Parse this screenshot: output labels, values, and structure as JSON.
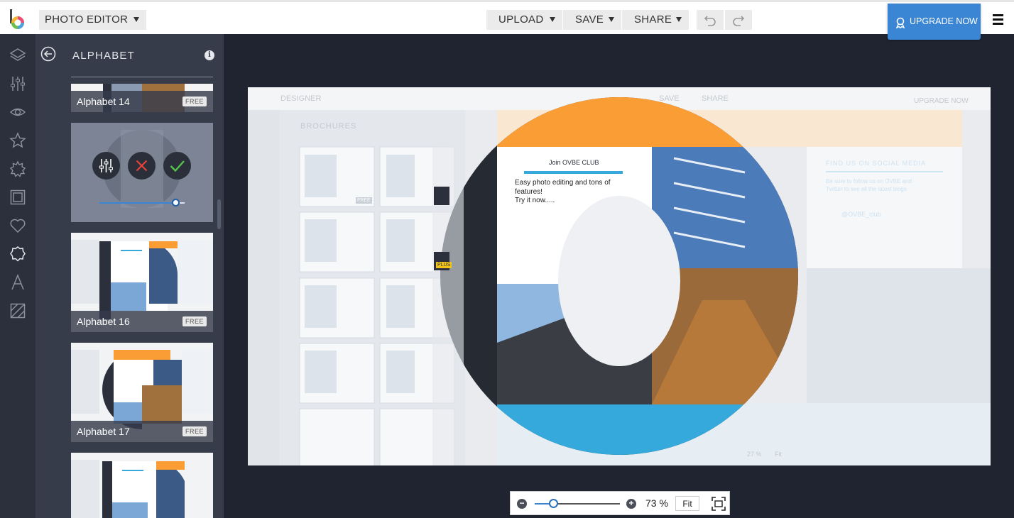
{
  "app": {
    "mode_label": "PHOTO EDITOR"
  },
  "toolbar": {
    "upload_label": "UPLOAD",
    "save_label": "SAVE",
    "share_label": "SHARE",
    "upgrade_label": "UPGRADE NOW"
  },
  "rail": {
    "icons": [
      "layers-icon",
      "sliders-icon",
      "eye-icon",
      "star-icon",
      "burst-icon",
      "frame-icon",
      "heart-icon",
      "badge-icon",
      "text-icon",
      "texture-icon"
    ],
    "active_index": 7
  },
  "panel": {
    "title": "ALPHABET",
    "items": [
      {
        "name": "Alphabet 14",
        "badge": "FREE"
      },
      {
        "name": "Alphabet 16",
        "badge": "FREE"
      },
      {
        "name": "Alphabet 17",
        "badge": "FREE"
      }
    ]
  },
  "canvas": {
    "ghost": {
      "mode_label": "DESIGNER",
      "save_label": "SAVE",
      "share_label": "SHARE",
      "upgrade_label": "UPGRADE NOW",
      "panel_title": "BROCHURES",
      "badge_free": "FREE",
      "badge_plus": "PLUS",
      "social_title": "FIND US ON SOCIAL MEDIA",
      "social_line1": "Be sure to follow us on OVBE and",
      "social_line2": "Twitter to see all the latest blogs",
      "social_handle": "@OVBE_club",
      "zoom_value": "27 %",
      "fit_label": "Fit"
    },
    "card": {
      "title": "Join OVBE CLUB",
      "line1": "Easy photo editing and tons of",
      "line2": "features!",
      "line3": "Try it now....."
    }
  },
  "zoom": {
    "value_label": "73 %",
    "fraction": 0.22,
    "fit_label": "Fit"
  },
  "colors": {
    "accent": "#3a86d4",
    "orange": "#fb9d35",
    "sky": "#36a9dc",
    "dark": "#1f2430"
  }
}
